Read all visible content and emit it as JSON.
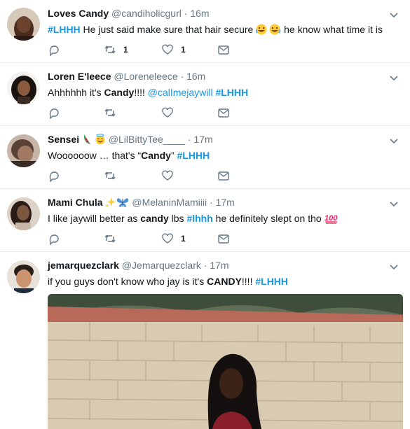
{
  "tweets": [
    {
      "name": "Loves Candy",
      "handle": "@candiholicgurl",
      "time": "16m",
      "text_parts": [
        "#LHHH",
        " He just said make sure that hair secure ",
        " he know what time it is"
      ],
      "retweets": "1",
      "likes": "1"
    },
    {
      "name": "Loren E'leece",
      "handle": "@Loreneleece",
      "time": "16m",
      "text_parts": [
        "Ahhhhhh it's ",
        "Candy",
        "!!!! ",
        "@calImejaywill",
        " ",
        "#LHHH"
      ],
      "retweets": "",
      "likes": ""
    },
    {
      "name": "Sensei",
      "handle": "@LilBittyTee____",
      "time": "17m",
      "text_parts": [
        "Woooooow … that's “",
        "Candy",
        "” ",
        "#LHHH"
      ],
      "retweets": "",
      "likes": ""
    },
    {
      "name": "Mami Chula",
      "handle": "@MelaninMamiiii",
      "time": "17m",
      "text_parts": [
        "I like jaywill better as ",
        "candy",
        " lbs ",
        "#lhhh",
        " he definitely slept on tho "
      ],
      "retweets": "",
      "likes": "1"
    },
    {
      "name": "jemarquezclark",
      "handle": "@Jemarquezclark",
      "time": "17m",
      "text_parts": [
        "if you guys don't know who jay is it's ",
        "CANDY",
        "!!!!  ",
        "#LHHH"
      ],
      "retweets": "",
      "likes": ""
    }
  ],
  "separator": "·",
  "colors": {
    "link": "#1b95e0",
    "muted": "#657786",
    "divider": "#e6ecf0",
    "text": "#14171a"
  },
  "icons": [
    "reply-icon",
    "retweet-icon",
    "like-icon",
    "dm-icon",
    "chevron-down-icon"
  ]
}
